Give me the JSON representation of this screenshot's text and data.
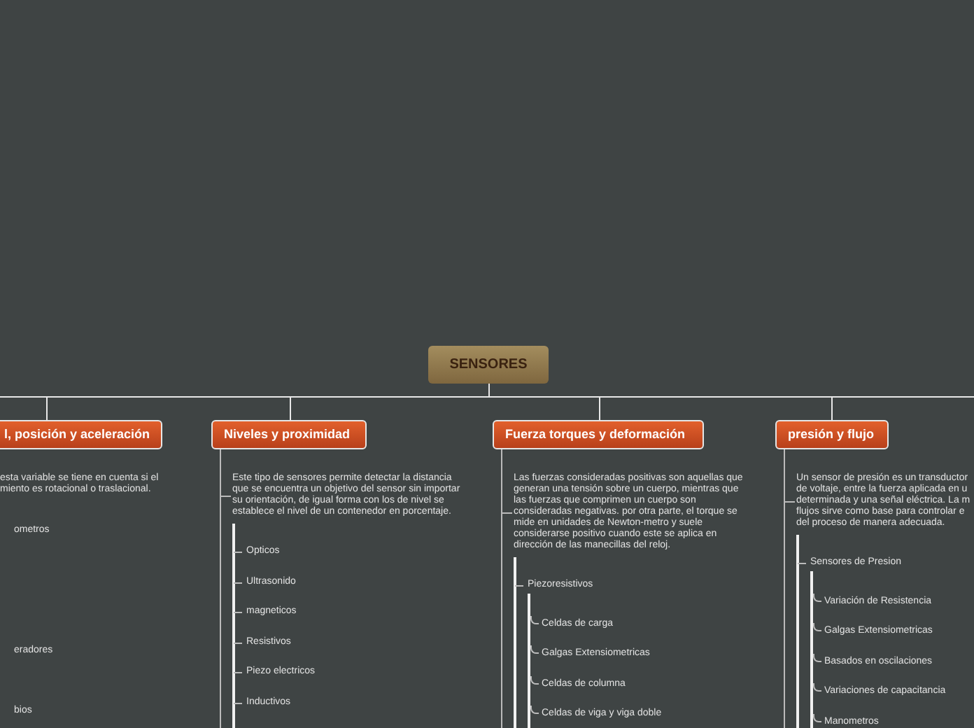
{
  "root": {
    "label": "SENSORES"
  },
  "branches": [
    {
      "label": "l, posición y aceleración",
      "description": [
        "esta variable se tiene en cuenta si el",
        "miento es rotacional o traslacional."
      ],
      "items": [
        {
          "label": "ometros"
        },
        {
          "label": "eradores"
        },
        {
          "label": "bios"
        }
      ]
    },
    {
      "label": "Niveles y proximidad",
      "description": [
        "Este tipo de sensores permite detectar la distancia",
        "que se encuentra un objetivo del sensor sin importar",
        "su orientación, de igual forma con los de nivel se",
        "establece el nivel de un contenedor en porcentaje."
      ],
      "items": [
        {
          "label": "Opticos"
        },
        {
          "label": "Ultrasonido"
        },
        {
          "label": "magneticos"
        },
        {
          "label": "Resistivos"
        },
        {
          "label": "Piezo electricos"
        },
        {
          "label": "Inductivos"
        }
      ]
    },
    {
      "label": "Fuerza torques y deformación",
      "description": [
        "Las fuerzas consideradas positivas son aquellas que",
        "generan una tensión sobre un cuerpo, mientras que",
        "las fuerzas que comprimen un cuerpo son",
        "consideradas negativas. por otra parte, el torque se",
        "mide en unidades de Newton-metro y suele",
        "considerarse positivo cuando este se aplica en",
        "dirección de las manecillas del reloj."
      ],
      "items": [
        {
          "label": "Piezoresistivos",
          "children": [
            {
              "label": "Celdas de carga"
            },
            {
              "label": "Galgas Extensiometricas"
            },
            {
              "label": "Celdas de columna"
            },
            {
              "label": "Celdas de viga y viga doble"
            }
          ]
        }
      ]
    },
    {
      "label": "presión y flujo",
      "description": [
        "Un sensor de presión es un transductor",
        "de voltaje, entre la fuerza aplicada en u",
        "determinada y una señal eléctrica. La m",
        "flujos sirve como base para controlar e",
        "del proceso de manera adecuada."
      ],
      "items": [
        {
          "label": "Sensores de Presion",
          "children": [
            {
              "label": "Variación de Resistencia"
            },
            {
              "label": "Galgas Extensiometricas"
            },
            {
              "label": "Basados en oscilaciones"
            },
            {
              "label": "Variaciones de capacitancia"
            },
            {
              "label": "Manometros"
            }
          ]
        }
      ]
    }
  ]
}
